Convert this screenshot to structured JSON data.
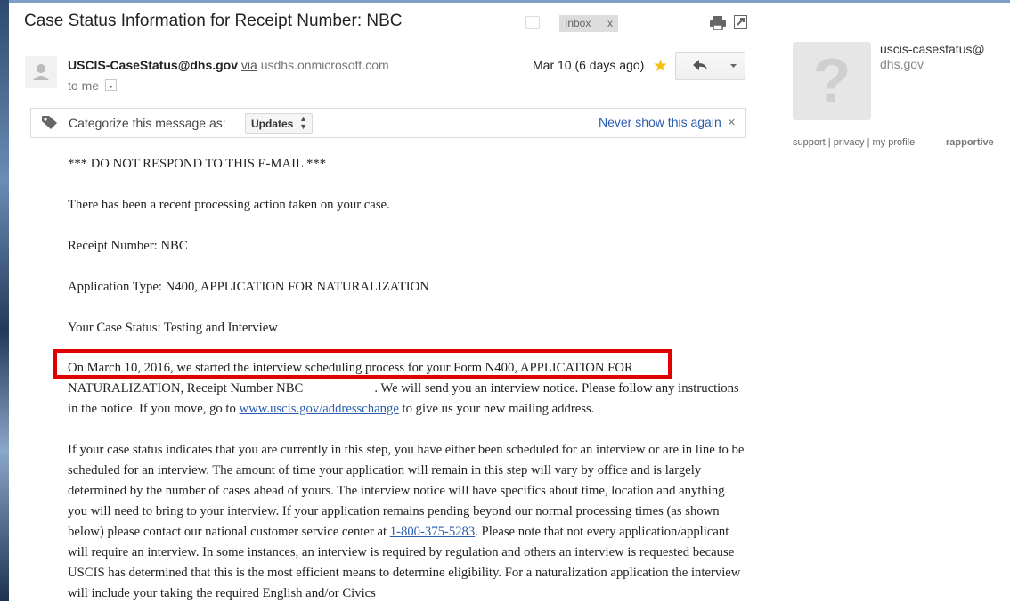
{
  "email": {
    "subject": "Case Status Information for Receipt Number: NBC",
    "label": "Inbox",
    "label_remove": "x",
    "sender": {
      "address": "USCIS-CaseStatus@dhs.gov",
      "via": "via",
      "via_domain": "usdhs.onmicrosoft.com",
      "to": "to me"
    },
    "date": "Mar 10 (6 days ago)"
  },
  "categorize": {
    "label": "Categorize this message as:",
    "selected": "Updates",
    "never_show": "Never show this again",
    "close": "×"
  },
  "body": {
    "warning": "*** DO NOT RESPOND TO THIS E-MAIL ***",
    "recent": "There has been a recent processing action taken on your case.",
    "receipt": "Receipt Number: NBC",
    "app_type": "Application Type: N400, APPLICATION FOR NATURALIZATION",
    "status": "Your Case Status: Testing and Interview",
    "para1_a": "On March 10, 2016, we started the interview scheduling process for your Form N400, APPLICATION FOR NATURALIZATION, Receipt Number NBC",
    "para1_b": ". We will send you an interview notice. Please follow any instructions in the notice. If you move, go to ",
    "para1_link": "www.uscis.gov/addresschange",
    "para1_c": " to give us your new mailing address.",
    "para2_a": "If your case status indicates that you are currently in this step, you have either been scheduled for an interview or are in line to be scheduled for an interview. The amount of time your application will remain in this step will vary by office and is largely determined by the number of cases ahead of yours. The interview notice will have specifics about time, location and anything you will need to bring to your interview. If your application remains pending beyond our normal processing times (as shown below) please contact our national customer service center at ",
    "para2_link": "1-800-375-5283",
    "para2_b": ". Please note that not every application/applicant will require an interview. In some instances, an interview is required by regulation and others an interview is requested because USCIS has determined that this is the most efficient means to determine eligibility. For a naturalization application the interview will include your taking the required English and/or Civics"
  },
  "rapportive": {
    "email_line1": "uscis-casestatus@",
    "email_line2": "dhs.gov",
    "avatar_glyph": "?",
    "support": "support",
    "privacy": "privacy",
    "profile": "my profile",
    "sep": "|",
    "brand": "rapportive"
  },
  "colors": {
    "link": "#2a5db0",
    "highlight_box": "#e00000",
    "star": "#f4c20d"
  },
  "icons": [
    "print-icon",
    "new-window-icon",
    "star-icon",
    "reply-icon",
    "chevron-down-icon",
    "tag-icon",
    "close-icon",
    "avatar-icon"
  ]
}
